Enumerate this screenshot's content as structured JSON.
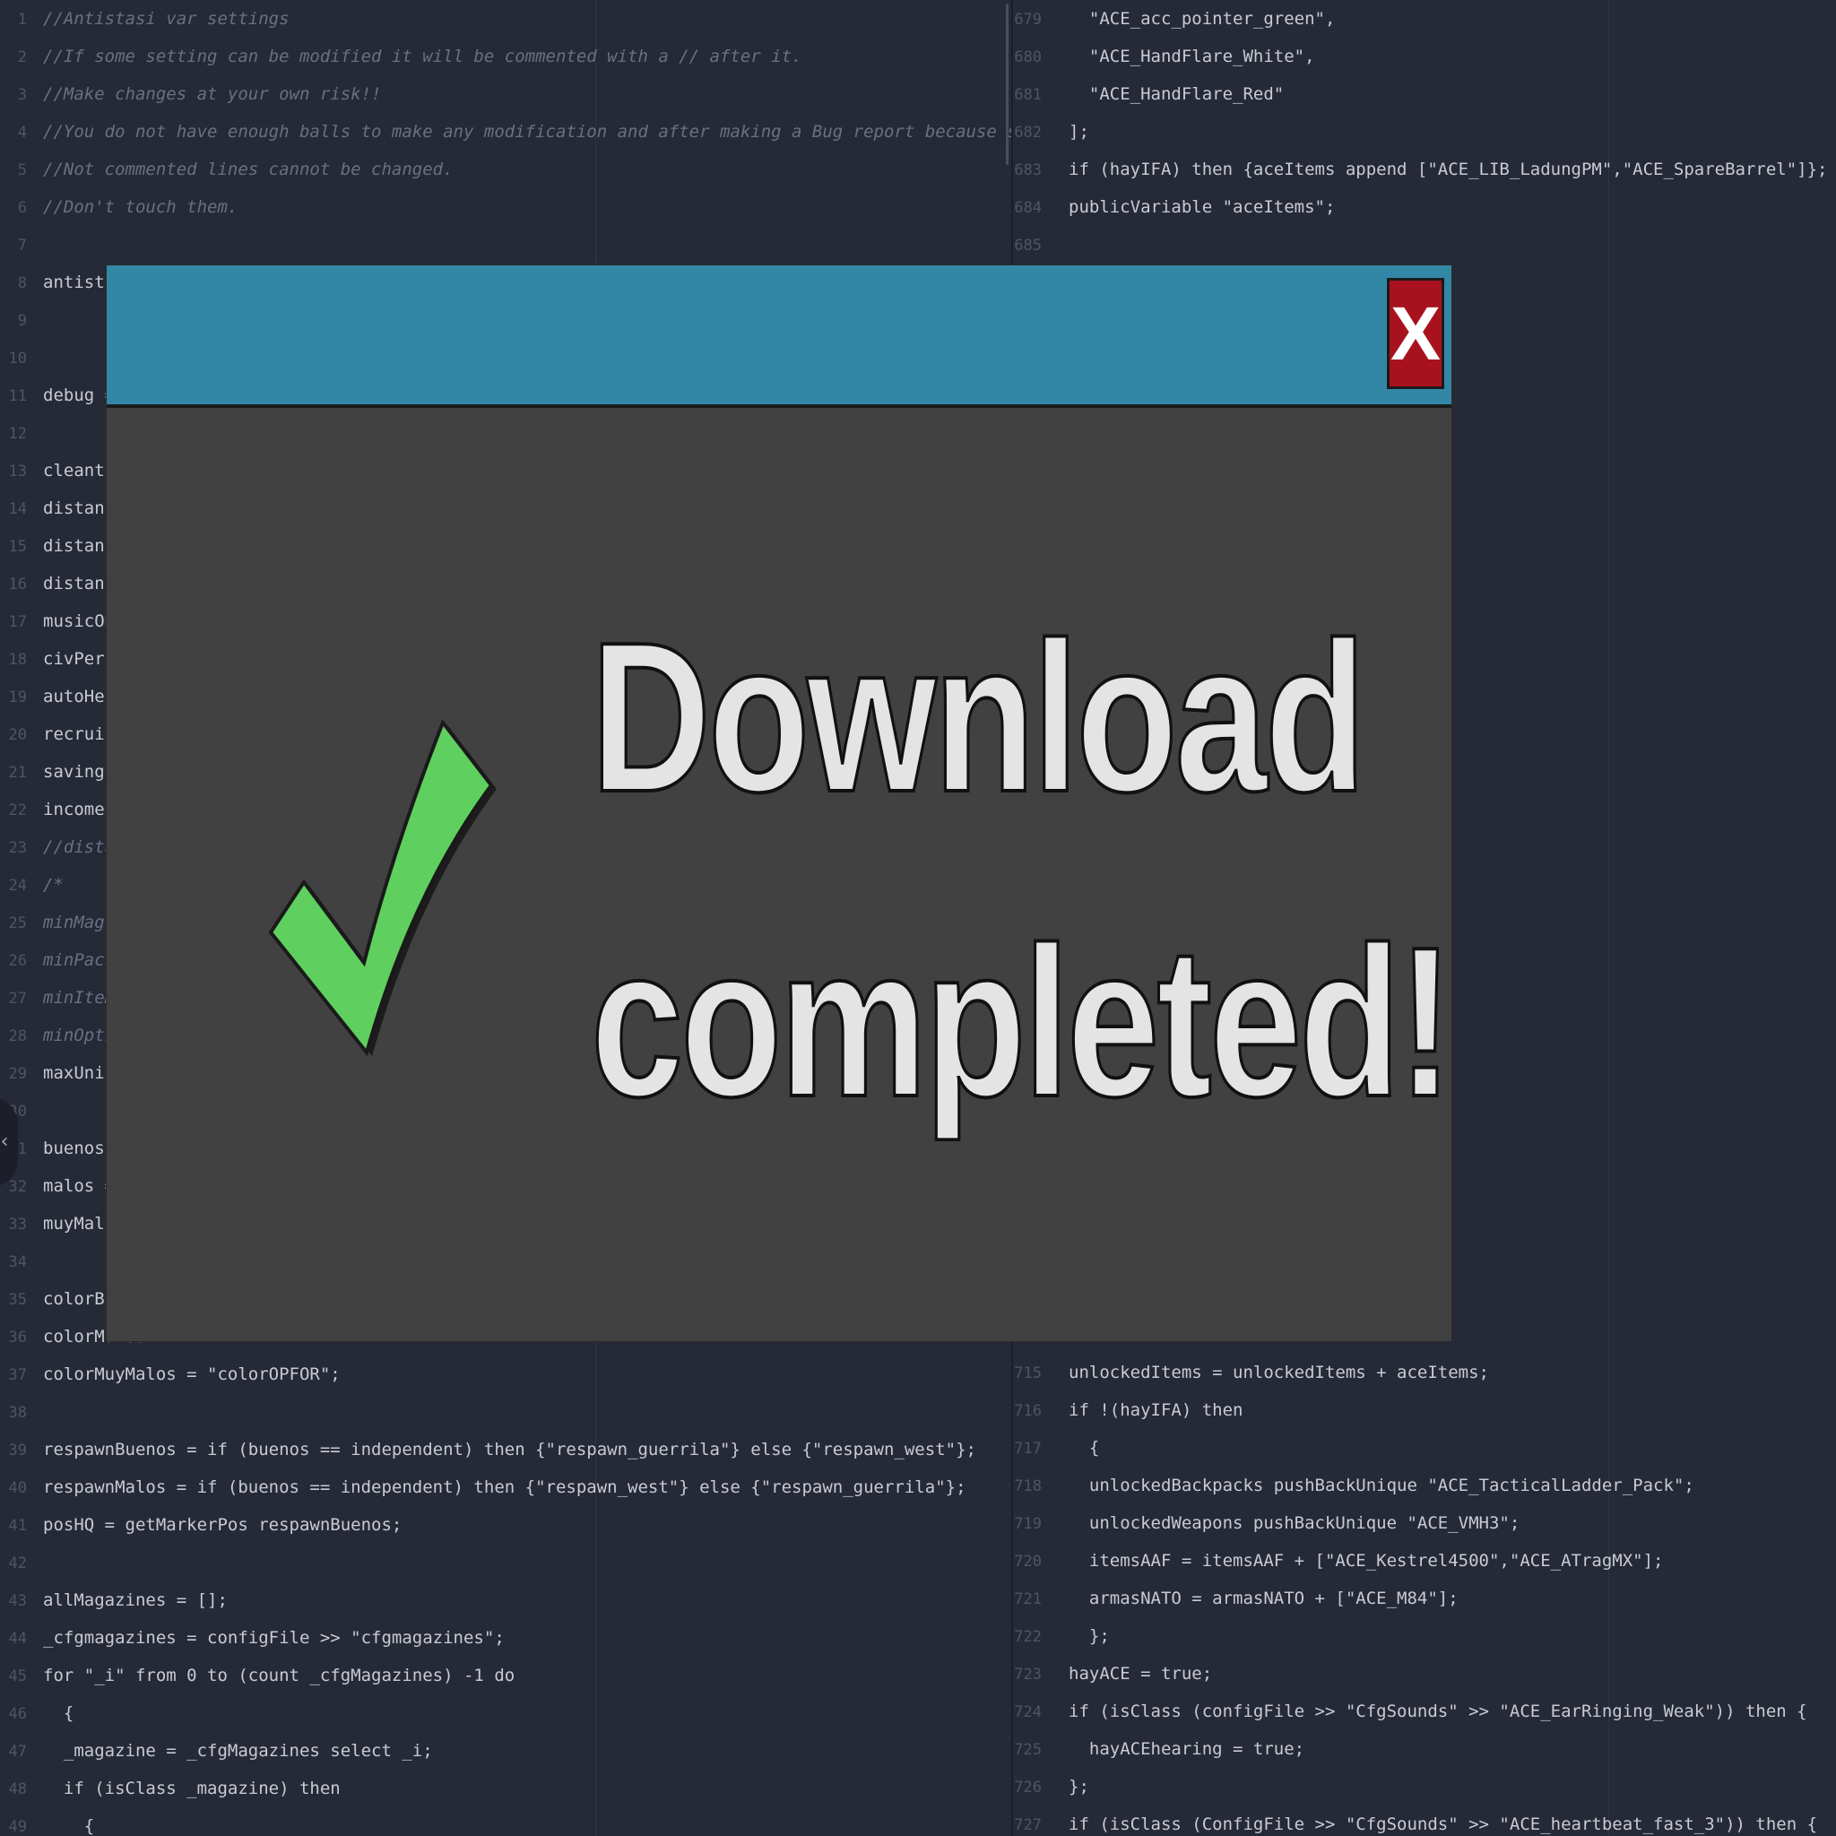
{
  "editor": {
    "left_pane": [
      {
        "n": "1",
        "text": "//Antistasi var settings",
        "comment": true
      },
      {
        "n": "2",
        "text": "//If some setting can be modified it will be commented with a // after it.",
        "comment": true
      },
      {
        "n": "3",
        "text": "//Make changes at your own risk!!",
        "comment": true
      },
      {
        "n": "4",
        "text": "//You do not have enough balls to make any modification and after making a Bug report because something is wrong. You don't wanna be there.",
        "comment": true
      },
      {
        "n": "5",
        "text": "//Not commented lines cannot be changed.",
        "comment": true
      },
      {
        "n": "6",
        "text": "//Don't touch them.",
        "comment": true
      },
      {
        "n": "7",
        "text": ""
      },
      {
        "n": "8",
        "text": "antistasi"
      },
      {
        "n": "9",
        "text": ""
      },
      {
        "n": "10",
        "text": ""
      },
      {
        "n": "11",
        "text": "debug = f"
      },
      {
        "n": "12",
        "text": ""
      },
      {
        "n": "13",
        "text": "cleantime"
      },
      {
        "n": "14",
        "text": "distancia"
      },
      {
        "n": "15",
        "text": "distancia"
      },
      {
        "n": "16",
        "text": "distancia"
      },
      {
        "n": "17",
        "text": "musicON ="
      },
      {
        "n": "18",
        "text": "civPerc ="
      },
      {
        "n": "19",
        "text": "autoHeal"
      },
      {
        "n": "20",
        "text": "recruitCo"
      },
      {
        "n": "21",
        "text": "savingCli"
      },
      {
        "n": "22",
        "text": "incomeRep"
      },
      {
        "n": "23",
        "text": "//distanc",
        "comment": true
      },
      {
        "n": "24",
        "text": "/*",
        "comment": true
      },
      {
        "n": "25",
        "text": "minMags =",
        "comment": true
      },
      {
        "n": "26",
        "text": "minPacks",
        "comment": true
      },
      {
        "n": "27",
        "text": "minItems",
        "comment": true
      },
      {
        "n": "28",
        "text": "minOptics",
        "comment": true
      },
      {
        "n": "29",
        "text": "maxUnits"
      },
      {
        "n": "30",
        "text": ""
      },
      {
        "n": "1",
        "text": "buenos ="
      },
      {
        "n": "32",
        "text": "malos = i"
      },
      {
        "n": "33",
        "text": "muyMalos"
      },
      {
        "n": "34",
        "text": ""
      },
      {
        "n": "35",
        "text": "colorBuen"
      },
      {
        "n": "36",
        "text": "colorMalos"
      },
      {
        "n": "37",
        "text": "colorMuyMalos = \"colorOPFOR\";"
      },
      {
        "n": "38",
        "text": ""
      },
      {
        "n": "39",
        "text": "respawnBuenos = if (buenos == independent) then {\"respawn_guerrila\"} else {\"respawn_west\"};"
      },
      {
        "n": "40",
        "text": "respawnMalos = if (buenos == independent) then {\"respawn_west\"} else {\"respawn_guerrila\"};"
      },
      {
        "n": "41",
        "text": "posHQ = getMarkerPos respawnBuenos;"
      },
      {
        "n": "42",
        "text": ""
      },
      {
        "n": "43",
        "text": "allMagazines = [];"
      },
      {
        "n": "44",
        "text": "_cfgmagazines = configFile >> \"cfgmagazines\";"
      },
      {
        "n": "45",
        "text": "for \"_i\" from 0 to (count _cfgMagazines) -1 do"
      },
      {
        "n": "46",
        "text": "  {"
      },
      {
        "n": "47",
        "text": "  _magazine = _cfgMagazines select _i;"
      },
      {
        "n": "48",
        "text": "  if (isClass _magazine) then"
      },
      {
        "n": "49",
        "text": "    {"
      }
    ],
    "right_pane_top": [
      {
        "n": "679",
        "text": "  \"ACE_acc_pointer_green\","
      },
      {
        "n": "680",
        "text": "  \"ACE_HandFlare_White\","
      },
      {
        "n": "681",
        "text": "  \"ACE_HandFlare_Red\""
      },
      {
        "n": "682",
        "text": "];"
      },
      {
        "n": "683",
        "text": "if (hayIFA) then {aceItems append [\"ACE_LIB_LadungPM\",\"ACE_SpareBarrel\"]};"
      },
      {
        "n": "684",
        "text": "publicVariable \"aceItems\";"
      },
      {
        "n": "685",
        "text": ""
      }
    ],
    "right_pane_bottom": [
      {
        "n": "715",
        "text": "unlockedItems = unlockedItems + aceItems;"
      },
      {
        "n": "716",
        "text": "if !(hayIFA) then"
      },
      {
        "n": "717",
        "text": "  {"
      },
      {
        "n": "718",
        "text": "  unlockedBackpacks pushBackUnique \"ACE_TacticalLadder_Pack\";"
      },
      {
        "n": "719",
        "text": "  unlockedWeapons pushBackUnique \"ACE_VMH3\";"
      },
      {
        "n": "720",
        "text": "  itemsAAF = itemsAAF + [\"ACE_Kestrel4500\",\"ACE_ATragMX\"];"
      },
      {
        "n": "721",
        "text": "  armasNATO = armasNATO + [\"ACE_M84\"];"
      },
      {
        "n": "722",
        "text": "  };"
      },
      {
        "n": "723",
        "text": "hayACE = true;"
      },
      {
        "n": "724",
        "text": "if (isClass (configFile >> \"CfgSounds\" >> \"ACE_EarRinging_Weak\")) then {"
      },
      {
        "n": "725",
        "text": "  hayACEhearing = true;"
      },
      {
        "n": "726",
        "text": "};"
      },
      {
        "n": "727",
        "text": "if (isClass (ConfigFile >> \"CfgSounds\" >> \"ACE_heartbeat_fast_3\")) then {"
      }
    ]
  },
  "modal": {
    "close_label": "X",
    "message_line1": "Download",
    "message_line2": "completed!",
    "icon": "checkmark-icon",
    "colors": {
      "header": "#3387a6",
      "body": "#414141",
      "close": "#a8121f",
      "check": "#5fd05f"
    }
  },
  "sidebar_toggle": {
    "label": "‹"
  }
}
